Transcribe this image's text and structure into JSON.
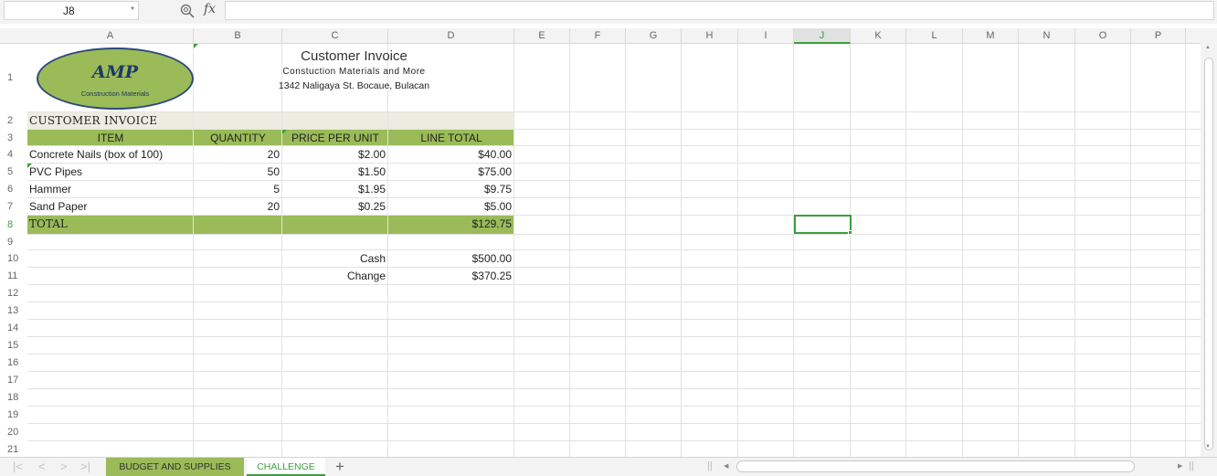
{
  "formula_bar": {
    "name_box": "J8",
    "fx_label": "fx",
    "formula": ""
  },
  "columns": [
    "A",
    "B",
    "C",
    "D",
    "E",
    "F",
    "G",
    "H",
    "I",
    "J",
    "K",
    "L",
    "M",
    "N",
    "O",
    "P"
  ],
  "rows": [
    "1",
    "2",
    "3",
    "4",
    "5",
    "6",
    "7",
    "8",
    "9",
    "10",
    "11",
    "12",
    "13",
    "14",
    "15",
    "16",
    "17",
    "18",
    "19",
    "20",
    "21"
  ],
  "selected": {
    "column": "J",
    "row": "8"
  },
  "logo": {
    "name": "AMP",
    "subtitle": "Construction Materials"
  },
  "header": {
    "title": "Customer Invoice",
    "subtitle": "Constuction Materials and More",
    "address": "1342 Naligaya St. Bocaue, Bulacan"
  },
  "invoice": {
    "section_title": "CUSTOMER INVOICE",
    "columns": [
      "ITEM",
      "QUANTITY",
      "PRICE PER UNIT",
      "LINE TOTAL"
    ],
    "items": [
      {
        "item": "Concrete Nails (box of 100)",
        "qty": "20",
        "price": "$2.00",
        "total": "$40.00"
      },
      {
        "item": "PVC Pipes",
        "qty": "50",
        "price": "$1.50",
        "total": "$75.00"
      },
      {
        "item": "Hammer",
        "qty": "5",
        "price": "$1.95",
        "total": "$9.75"
      },
      {
        "item": "Sand Paper",
        "qty": "20",
        "price": "$0.25",
        "total": "$5.00"
      }
    ],
    "total_label": "TOTAL",
    "total_value": "$129.75",
    "cash_label": "Cash",
    "cash_value": "$500.00",
    "change_label": "Change",
    "change_value": "$370.25"
  },
  "sheet_tabs": [
    {
      "label": "BUDGET AND SUPPLIES",
      "active": false
    },
    {
      "label": "CHALLENGE",
      "active": true
    }
  ],
  "add_sheet": "+",
  "colors": {
    "green_accent": "#9bbb59",
    "select_green": "#3c9e3c",
    "logo_border": "#2e4a7d",
    "section_fill": "#eeece1"
  }
}
